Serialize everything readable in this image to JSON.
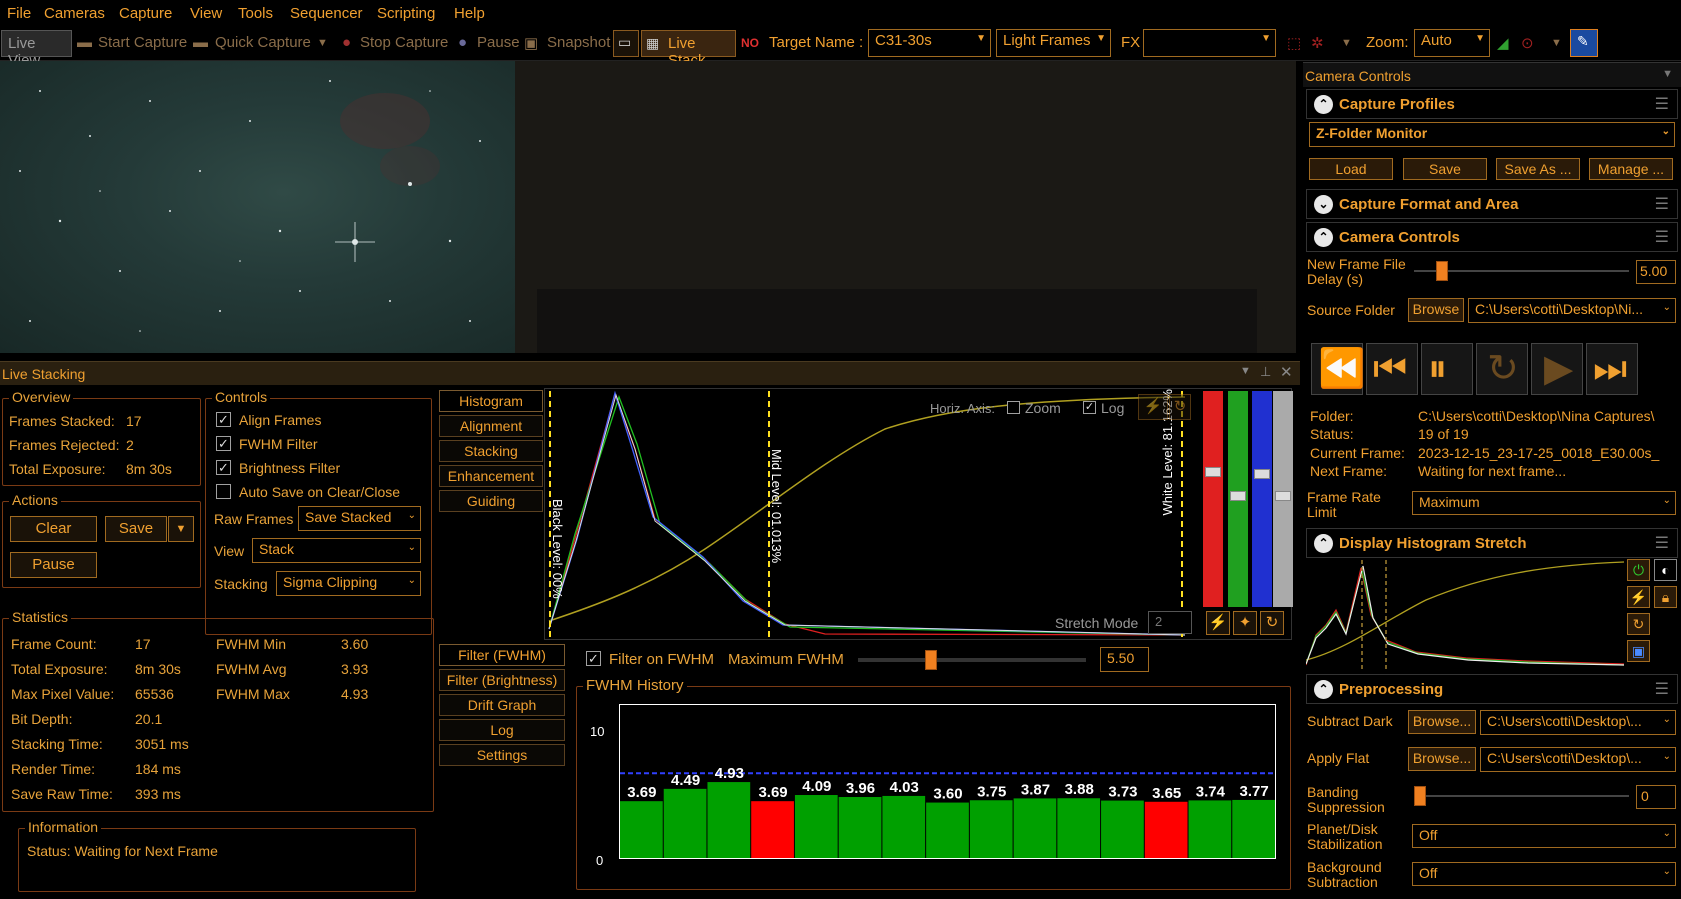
{
  "menu": [
    "File",
    "Cameras",
    "Capture",
    "View",
    "Tools",
    "Sequencer",
    "Scripting",
    "Help"
  ],
  "toolbar": {
    "live_view": "Live View",
    "start_capture": "Start Capture",
    "quick_capture": "Quick Capture",
    "stop_capture": "Stop Capture",
    "pause": "Pause",
    "snapshot": "Snapshot",
    "live_stack": "Live Stack",
    "target_name_label": "Target Name :",
    "target_name": "C31-30s",
    "frame_type": "Light Frames",
    "fx_label": "FX",
    "fx_value": "",
    "zoom_label": "Zoom:",
    "zoom_value": "Auto"
  },
  "live_stacking": {
    "title": "Live Stacking",
    "overview": {
      "title": "Overview",
      "frames_stacked_label": "Frames Stacked:",
      "frames_stacked": "17",
      "frames_rejected_label": "Frames Rejected:",
      "frames_rejected": "2",
      "total_exposure_label": "Total Exposure:",
      "total_exposure": "8m 30s"
    },
    "actions": {
      "title": "Actions",
      "clear": "Clear",
      "save": "Save",
      "pause": "Pause"
    },
    "controls": {
      "title": "Controls",
      "align_frames": "Align Frames",
      "align_checked": true,
      "fwhm_filter": "FWHM Filter",
      "fwhm_checked": true,
      "brightness_filter": "Brightness Filter",
      "brightness_checked": true,
      "auto_save": "Auto Save on Clear/Close",
      "auto_save_checked": false,
      "raw_frames_label": "Raw Frames",
      "raw_frames": "Save Stacked",
      "view_label": "View",
      "view": "Stack",
      "stacking_label": "Stacking",
      "stacking": "Sigma Clipping"
    },
    "statistics": {
      "title": "Statistics",
      "rows": [
        {
          "label": "Frame Count:",
          "value": "17"
        },
        {
          "label": "Total Exposure:",
          "value": "8m 30s"
        },
        {
          "label": "Max Pixel Value:",
          "value": "65536"
        },
        {
          "label": "Bit Depth:",
          "value": "20.1"
        },
        {
          "label": "Stacking Time:",
          "value": "3051 ms"
        },
        {
          "label": "Render Time:",
          "value": "184 ms"
        },
        {
          "label": "Save Raw Time:",
          "value": "393 ms"
        }
      ],
      "fwhm": [
        {
          "label": "FWHM Min",
          "value": "3.60"
        },
        {
          "label": "FWHM Avg",
          "value": "3.93"
        },
        {
          "label": "FWHM Max",
          "value": "4.93"
        }
      ]
    },
    "information": {
      "title": "Information",
      "status": "Status: Waiting for Next Frame"
    },
    "tabs_top": [
      "Histogram",
      "Alignment",
      "Stacking",
      "Enhancement",
      "Guiding"
    ],
    "tabs_bottom": [
      "Filter (FWHM)",
      "Filter (Brightness)",
      "Drift Graph",
      "Log",
      "Settings"
    ],
    "histogram": {
      "horiz_axis": "Horiz. Axis:",
      "zoom": "Zoom",
      "log": "Log",
      "log_checked": true,
      "black_level": "Black Level: 00%",
      "mid_level": "Mid Level: 01.013%",
      "white_level": "White Level: 81.162%",
      "stretch_mode": "Stretch Mode",
      "stretch_value": "2"
    },
    "filter": {
      "filter_on_fwhm": "Filter on FWHM",
      "max_fwhm_label": "Maximum FWHM",
      "max_fwhm": "5.50",
      "max_fwhm_frac": 0.32
    }
  },
  "chart_data": {
    "type": "bar",
    "title": "FWHM History",
    "ylim": [
      0,
      10
    ],
    "yticks": [
      "10",
      "0"
    ],
    "threshold": 5.5,
    "values": [
      3.69,
      4.49,
      4.93,
      3.69,
      4.09,
      3.96,
      4.03,
      3.6,
      3.75,
      3.87,
      3.88,
      3.73,
      3.65,
      3.74,
      3.77
    ],
    "labels": [
      "3.69",
      "4.49",
      "4.93",
      "3.69",
      "4.09",
      "3.96",
      "4.03",
      "3.60",
      "3.75",
      "3.87",
      "3.88",
      "3.73",
      "3.65",
      "3.74",
      "3.77"
    ],
    "rejected": [
      false,
      false,
      false,
      true,
      false,
      false,
      false,
      false,
      false,
      false,
      false,
      false,
      true,
      false,
      false
    ],
    "colors": {
      "accepted": "#00a000",
      "rejected": "#ff0000"
    }
  },
  "right_panel": {
    "title": "Camera Controls",
    "capture_profiles": {
      "title": "Capture Profiles",
      "profile": "Z-Folder Monitor",
      "load": "Load",
      "save": "Save",
      "save_as": "Save As ...",
      "manage": "Manage ..."
    },
    "capture_format": {
      "title": "Capture Format and Area"
    },
    "camera_controls": {
      "title": "Camera Controls",
      "new_frame_delay_label": "New Frame File Delay (s)",
      "new_frame_delay": "5.00",
      "delay_frac": 0.13,
      "source_folder_label": "Source Folder",
      "browse": "Browse",
      "source_folder": "C:\\Users\\cotti\\Desktop\\Ni...",
      "folder_label": "Folder:",
      "folder": "C:\\Users\\cotti\\Desktop\\Nina Captures\\",
      "status_label": "Status:",
      "status": "19 of 19",
      "current_frame_label": "Current Frame:",
      "current_frame": "2023-12-15_23-17-25_0018_E30.00s_",
      "next_frame_label": "Next Frame:",
      "next_frame": "Waiting for next frame...",
      "frame_rate_label": "Frame Rate Limit",
      "frame_rate": "Maximum"
    },
    "display_histogram": {
      "title": "Display Histogram Stretch"
    },
    "preprocessing": {
      "title": "Preprocessing",
      "subtract_dark_label": "Subtract Dark",
      "browse": "Browse...",
      "dark_path": "C:\\Users\\cotti\\Desktop\\...",
      "apply_flat_label": "Apply Flat",
      "flat_path": "C:\\Users\\cotti\\Desktop\\...",
      "banding_label": "Banding Suppression",
      "banding_value": "0",
      "planet_label": "Planet/Disk Stabilization",
      "planet_value": "Off",
      "background_label": "Background Subtraction",
      "background_value": "Off"
    }
  }
}
